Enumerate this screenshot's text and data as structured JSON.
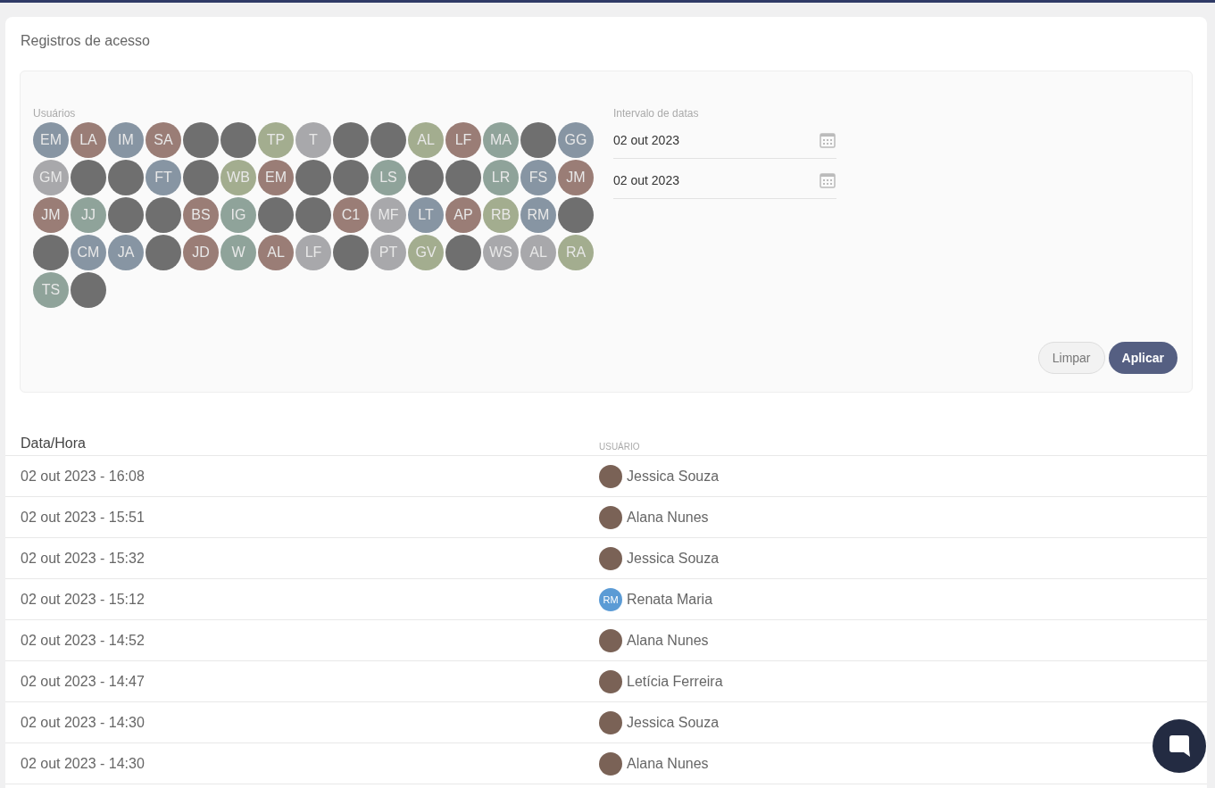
{
  "page_title": "Registros de acesso",
  "filters": {
    "users_label": "Usuários",
    "users": [
      {
        "kind": "initials",
        "text": "EM",
        "color": "#8795a3"
      },
      {
        "kind": "initials",
        "text": "LA",
        "color": "#9a7d76"
      },
      {
        "kind": "initials",
        "text": "IM",
        "color": "#8795a3"
      },
      {
        "kind": "initials",
        "text": "SA",
        "color": "#9a7d76"
      },
      {
        "kind": "photo"
      },
      {
        "kind": "photo"
      },
      {
        "kind": "initials",
        "text": "TP",
        "color": "#a3ad8f"
      },
      {
        "kind": "initials",
        "text": "T",
        "color": "#a8a8ab"
      },
      {
        "kind": "photo"
      },
      {
        "kind": "photo"
      },
      {
        "kind": "initials",
        "text": "AL",
        "color": "#a3ad8f"
      },
      {
        "kind": "initials",
        "text": "LF",
        "color": "#9a7d76"
      },
      {
        "kind": "initials",
        "text": "MA",
        "color": "#8fa39a"
      },
      {
        "kind": "photo"
      },
      {
        "kind": "initials",
        "text": "GG",
        "color": "#8795a3"
      },
      {
        "kind": "initials",
        "text": "GM",
        "color": "#a8a8ab"
      },
      {
        "kind": "photo"
      },
      {
        "kind": "photo"
      },
      {
        "kind": "initials",
        "text": "FT",
        "color": "#8795a3"
      },
      {
        "kind": "photo"
      },
      {
        "kind": "initials",
        "text": "WB",
        "color": "#a3ad8f"
      },
      {
        "kind": "initials",
        "text": "EM",
        "color": "#9a7d76"
      },
      {
        "kind": "photo"
      },
      {
        "kind": "photo"
      },
      {
        "kind": "initials",
        "text": "LS",
        "color": "#8fa39a"
      },
      {
        "kind": "photo"
      },
      {
        "kind": "photo"
      },
      {
        "kind": "initials",
        "text": "LR",
        "color": "#8fa39a"
      },
      {
        "kind": "initials",
        "text": "FS",
        "color": "#8795a3"
      },
      {
        "kind": "initials",
        "text": "JM",
        "color": "#9a7d76"
      },
      {
        "kind": "initials",
        "text": "JM",
        "color": "#9a7d76"
      },
      {
        "kind": "initials",
        "text": "JJ",
        "color": "#8fa39a"
      },
      {
        "kind": "photo"
      },
      {
        "kind": "photo"
      },
      {
        "kind": "initials",
        "text": "BS",
        "color": "#9a7d76"
      },
      {
        "kind": "initials",
        "text": "IG",
        "color": "#8fa39a"
      },
      {
        "kind": "photo"
      },
      {
        "kind": "photo"
      },
      {
        "kind": "initials",
        "text": "C1",
        "color": "#9a7d76"
      },
      {
        "kind": "initials",
        "text": "MF",
        "color": "#a8a8ab"
      },
      {
        "kind": "initials",
        "text": "LT",
        "color": "#8795a3"
      },
      {
        "kind": "initials",
        "text": "AP",
        "color": "#9a7d76"
      },
      {
        "kind": "initials",
        "text": "RB",
        "color": "#a3ad8f"
      },
      {
        "kind": "initials",
        "text": "RM",
        "color": "#8795a3"
      },
      {
        "kind": "photo"
      },
      {
        "kind": "photo"
      },
      {
        "kind": "initials",
        "text": "CM",
        "color": "#8795a3"
      },
      {
        "kind": "initials",
        "text": "JA",
        "color": "#8795a3"
      },
      {
        "kind": "photo"
      },
      {
        "kind": "initials",
        "text": "JD",
        "color": "#9a7d76"
      },
      {
        "kind": "initials",
        "text": "W",
        "color": "#8fa39a"
      },
      {
        "kind": "initials",
        "text": "AL",
        "color": "#9a7d76"
      },
      {
        "kind": "initials",
        "text": "LF",
        "color": "#a8a8ab"
      },
      {
        "kind": "photo"
      },
      {
        "kind": "initials",
        "text": "PT",
        "color": "#a8a8ab"
      },
      {
        "kind": "initials",
        "text": "GV",
        "color": "#a3ad8f"
      },
      {
        "kind": "photo"
      },
      {
        "kind": "initials",
        "text": "WS",
        "color": "#a8a8ab"
      },
      {
        "kind": "initials",
        "text": "AL",
        "color": "#a8a8ab"
      },
      {
        "kind": "initials",
        "text": "RA",
        "color": "#a3ad8f"
      },
      {
        "kind": "initials",
        "text": "TS",
        "color": "#8fa39a"
      },
      {
        "kind": "photo"
      }
    ],
    "date_label": "Intervalo de datas",
    "date_from": "02 out 2023",
    "date_to": "02 out 2023",
    "buttons": {
      "clear": "Limpar",
      "apply": "Aplicar"
    }
  },
  "table": {
    "columns": [
      "Data/Hora",
      "USUÁRIO"
    ],
    "rows": [
      {
        "datetime": "02 out 2023 - 16:08",
        "user": "Jessica Souza",
        "avatar": {
          "kind": "photo"
        }
      },
      {
        "datetime": "02 out 2023 - 15:51",
        "user": "Alana Nunes",
        "avatar": {
          "kind": "photo"
        }
      },
      {
        "datetime": "02 out 2023 - 15:32",
        "user": "Jessica Souza",
        "avatar": {
          "kind": "photo"
        }
      },
      {
        "datetime": "02 out 2023 - 15:12",
        "user": "Renata Maria",
        "avatar": {
          "kind": "initials",
          "text": "RM",
          "color": "#5b9bd5"
        }
      },
      {
        "datetime": "02 out 2023 - 14:52",
        "user": "Alana Nunes",
        "avatar": {
          "kind": "photo"
        }
      },
      {
        "datetime": "02 out 2023 - 14:47",
        "user": "Letícia Ferreira",
        "avatar": {
          "kind": "photo"
        }
      },
      {
        "datetime": "02 out 2023 - 14:30",
        "user": "Jessica Souza",
        "avatar": {
          "kind": "photo"
        }
      },
      {
        "datetime": "02 out 2023 - 14:30",
        "user": "Alana Nunes",
        "avatar": {
          "kind": "photo"
        }
      }
    ]
  }
}
